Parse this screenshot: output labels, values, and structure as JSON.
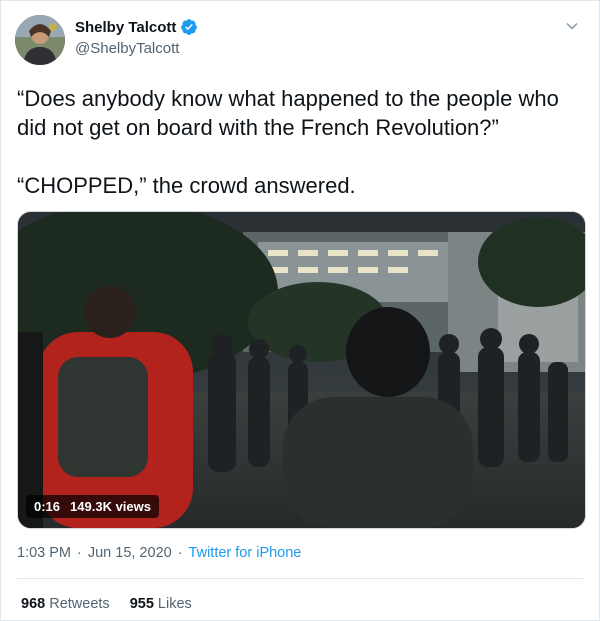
{
  "author": {
    "name": "Shelby Talcott",
    "handle": "@ShelbyTalcott",
    "verified": true
  },
  "tweet": {
    "line1": "“Does anybody know what happened to the people who did not get on board with the French Revolution?”",
    "line2": "“CHOPPED,” the crowd answered."
  },
  "video": {
    "duration": "0:16",
    "views": "149.3K views"
  },
  "meta": {
    "time": "1:03 PM",
    "separator": "·",
    "date": "Jun 15, 2020",
    "source": "Twitter for iPhone"
  },
  "stats": {
    "retweets_count": "968",
    "retweets_label": "Retweets",
    "likes_count": "955",
    "likes_label": "Likes"
  },
  "colors": {
    "link": "#1d9bf0",
    "secondary_text": "#536471",
    "primary_text": "#0f1419"
  }
}
